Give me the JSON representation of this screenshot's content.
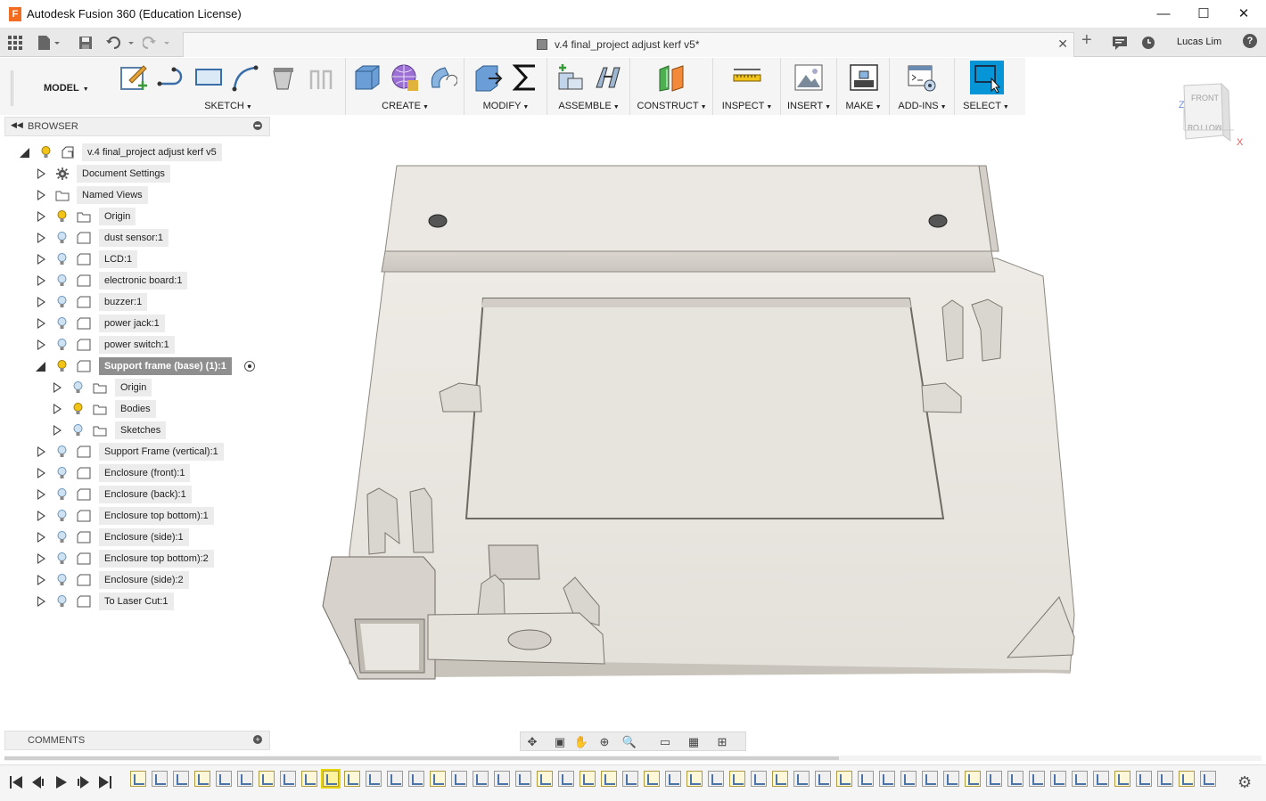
{
  "window": {
    "title": "Autodesk Fusion 360 (Education License)",
    "logo_letter": "F",
    "minimize": "—",
    "maximize": "☐",
    "close": "✕"
  },
  "tabbar": {
    "document_title": "v.4 final_project adjust kerf v5*",
    "tab_close": "✕",
    "new_tab": "+",
    "user_name": "Lucas Lim",
    "help": "?"
  },
  "toolbar": {
    "workspace": "MODEL",
    "groups": [
      {
        "label": "SKETCH"
      },
      {
        "label": "CREATE"
      },
      {
        "label": "MODIFY"
      },
      {
        "label": "ASSEMBLE"
      },
      {
        "label": "CONSTRUCT"
      },
      {
        "label": "INSPECT"
      },
      {
        "label": "INSERT"
      },
      {
        "label": "MAKE"
      },
      {
        "label": "ADD-INS"
      },
      {
        "label": "SELECT"
      }
    ]
  },
  "browser": {
    "label": "BROWSER",
    "root": "v.4 final_project adjust kerf v5",
    "items": [
      {
        "label": "Document Settings",
        "icon": "gear-icon"
      },
      {
        "label": "Named Views",
        "icon": "folder-icon"
      },
      {
        "label": "Origin",
        "icon": "folder-icon",
        "bulb": "on"
      },
      {
        "label": "dust sensor:1",
        "icon": "component-icon",
        "bulb": "off"
      },
      {
        "label": "LCD:1",
        "icon": "component-icon",
        "bulb": "off"
      },
      {
        "label": "electronic board:1",
        "icon": "component-icon",
        "bulb": "off"
      },
      {
        "label": "buzzer:1",
        "icon": "component-icon",
        "bulb": "off"
      },
      {
        "label": "power jack:1",
        "icon": "component-icon",
        "bulb": "off"
      },
      {
        "label": "power switch:1",
        "icon": "component-icon",
        "bulb": "off"
      },
      {
        "label": "Support frame (base) (1):1",
        "icon": "component-icon",
        "bulb": "on",
        "selected": true
      },
      {
        "label": "Origin",
        "icon": "folder-icon",
        "bulb": "off",
        "child": true
      },
      {
        "label": "Bodies",
        "icon": "folder-icon",
        "bulb": "on",
        "child": true
      },
      {
        "label": "Sketches",
        "icon": "folder-icon",
        "bulb": "off",
        "child": true
      },
      {
        "label": "Support Frame (vertical):1",
        "icon": "component-icon",
        "bulb": "off"
      },
      {
        "label": "Enclosure (front):1",
        "icon": "component-icon",
        "bulb": "off"
      },
      {
        "label": "Enclosure (back):1",
        "icon": "component-icon",
        "bulb": "off"
      },
      {
        "label": "Enclosure top bottom):1",
        "icon": "component-icon",
        "bulb": "off"
      },
      {
        "label": "Enclosure (side):1",
        "icon": "component-icon",
        "bulb": "off"
      },
      {
        "label": "Enclosure top bottom):2",
        "icon": "component-icon",
        "bulb": "off"
      },
      {
        "label": "Enclosure (side):2",
        "icon": "component-icon",
        "bulb": "off"
      },
      {
        "label": "To Laser Cut:1",
        "icon": "component-icon",
        "bulb": "off"
      }
    ]
  },
  "viewcube": {
    "face_front": "FRONT",
    "face_bottom": "BOTTOM",
    "axis_z": "Z",
    "axis_x": "X"
  },
  "comments": {
    "label": "COMMENTS"
  },
  "colors": {
    "accent": "#0696d7",
    "model_face": "#e8e5e0",
    "selected_row": "#8f8f8f",
    "bulb_on": "#f2c318",
    "bulb_off": "#9fc3e0"
  }
}
